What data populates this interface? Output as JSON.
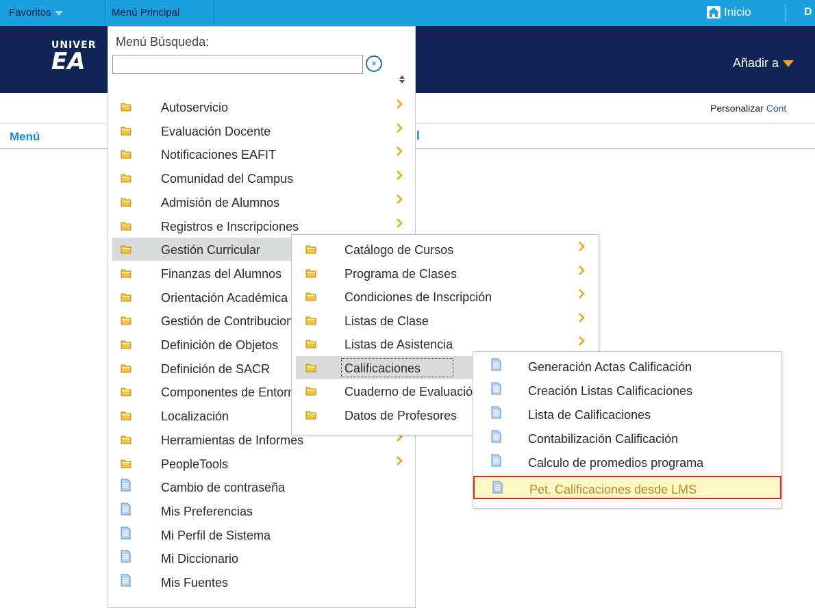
{
  "topbar": {
    "favoritos": "Favoritos",
    "menu_principal": "Menú Principal",
    "inicio": "Inicio",
    "cut_text": "D"
  },
  "banner": {
    "logo_top": "UNIVER",
    "logo_bottom": "EA",
    "add_to": "Añadir a"
  },
  "page": {
    "personalizar": "Personalizar",
    "personalizar_link": "Cont",
    "menu_title": "Menú",
    "stray_char": "l"
  },
  "search": {
    "label": "Menú Búsqueda:",
    "value": "",
    "go_symbol": "»"
  },
  "main_menu": [
    {
      "label": "Autoservicio",
      "type": "folder",
      "has_submenu": true
    },
    {
      "label": "Evaluación Docente",
      "type": "folder",
      "has_submenu": true
    },
    {
      "label": "Notificaciones EAFIT",
      "type": "folder",
      "has_submenu": true
    },
    {
      "label": "Comunidad del Campus",
      "type": "folder",
      "has_submenu": true
    },
    {
      "label": "Admisión de Alumnos",
      "type": "folder",
      "has_submenu": true
    },
    {
      "label": "Registros e Inscripciones",
      "type": "folder",
      "has_submenu": true
    },
    {
      "label": "Gestión Curricular",
      "type": "folder",
      "has_submenu": true,
      "active": true
    },
    {
      "label": "Finanzas del Alumnos",
      "type": "folder",
      "has_submenu": true
    },
    {
      "label": "Orientación Académica",
      "type": "folder",
      "has_submenu": true
    },
    {
      "label": "Gestión de Contribuciones",
      "type": "folder",
      "has_submenu": true
    },
    {
      "label": "Definición de Objetos",
      "type": "folder",
      "has_submenu": true
    },
    {
      "label": "Definición de SACR",
      "type": "folder",
      "has_submenu": true
    },
    {
      "label": "Componentes de Entorno",
      "type": "folder",
      "has_submenu": true
    },
    {
      "label": "Localización",
      "type": "folder",
      "has_submenu": true
    },
    {
      "label": "Herramientas de Informes",
      "type": "folder",
      "has_submenu": true
    },
    {
      "label": "PeopleTools",
      "type": "folder",
      "has_submenu": true
    },
    {
      "label": "Cambio de contraseña",
      "type": "page",
      "has_submenu": false
    },
    {
      "label": "Mis Preferencias",
      "type": "page",
      "has_submenu": false
    },
    {
      "label": "Mi Perfil de Sistema",
      "type": "page",
      "has_submenu": false
    },
    {
      "label": "Mi Diccionario",
      "type": "page",
      "has_submenu": false
    },
    {
      "label": "Mis Fuentes",
      "type": "page",
      "has_submenu": false
    }
  ],
  "submenu": [
    {
      "label": "Catálogo de Cursos",
      "has_submenu": true
    },
    {
      "label": "Programa de Clases",
      "has_submenu": true
    },
    {
      "label": "Condiciones de Inscripción",
      "has_submenu": true
    },
    {
      "label": "Listas de Clase",
      "has_submenu": true
    },
    {
      "label": "Listas de Asistencia",
      "has_submenu": true
    },
    {
      "label": "Calificaciones",
      "has_submenu": true,
      "active": true
    },
    {
      "label": "Cuaderno de Evaluación",
      "has_submenu": true
    },
    {
      "label": "Datos de Profesores",
      "has_submenu": true
    }
  ],
  "subsubmenu": [
    {
      "label": "Generación Actas Calificación"
    },
    {
      "label": "Creación Listas Calificaciones"
    },
    {
      "label": "Lista de Calificaciones"
    },
    {
      "label": "Contabilización Calificación"
    },
    {
      "label": "Calculo de promedios programa"
    },
    {
      "label": "Pet. Calificaciones desde LMS",
      "selected": true
    }
  ],
  "colors": {
    "topbar": "#1ba0dd",
    "banner": "#102456",
    "link": "#1b8dcf",
    "folder": "#f4c53b",
    "chevron": "#f2a21b",
    "page_icon": "#b7d3ee",
    "selected_bg": "#fcf9c4",
    "selected_border": "#e12229",
    "selected_text": "#c0852a",
    "active_row": "#d9dcdb"
  }
}
